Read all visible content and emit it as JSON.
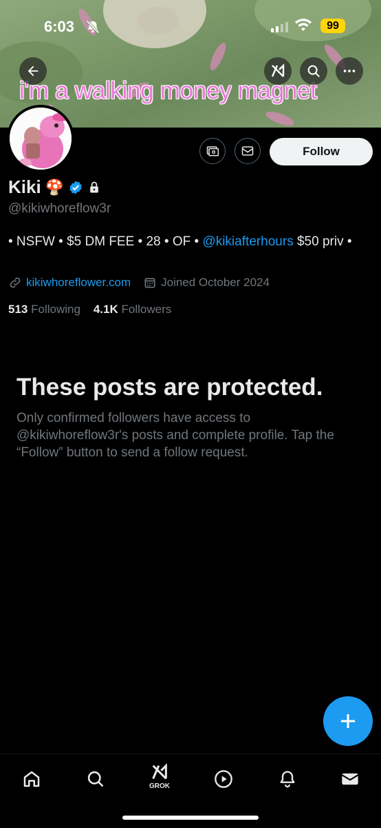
{
  "status_bar": {
    "time": "6:03",
    "battery": "99"
  },
  "banner": {
    "tagline": "i'm a walking money magnet"
  },
  "profile": {
    "display_name": "Kiki",
    "name_emoji": "🍄",
    "handle": "@kikiwhoreflow3r",
    "bio_prefix": "• NSFW • $5 DM FEE • 28 • OF • ",
    "bio_mention": "@kikiafterhours",
    "bio_suffix": " $50 priv •",
    "website": "kikiwhoreflower.com",
    "joined": "Joined October 2024",
    "following_count": "513",
    "following_label": "Following",
    "followers_count": "4.1K",
    "followers_label": "Followers",
    "follow_button": "Follow"
  },
  "protected_notice": {
    "title": "These posts are protected.",
    "body": "Only confirmed followers have access to @kikiwhoreflow3r's posts and complete profile. Tap the “Follow” button to send a follow request."
  },
  "tabbar": {
    "grok_label": "GROK"
  },
  "colors": {
    "accent": "#1d9bf0",
    "background": "#000000",
    "muted_text": "#71767b"
  },
  "icons": [
    "back-arrow-icon",
    "grok-icon",
    "search-icon",
    "more-icon",
    "subscribe-icon",
    "message-icon",
    "verified-badge-icon",
    "lock-icon",
    "link-icon",
    "calendar-icon",
    "plus-icon",
    "home-icon",
    "play-icon",
    "bell-icon",
    "mail-icon"
  ]
}
